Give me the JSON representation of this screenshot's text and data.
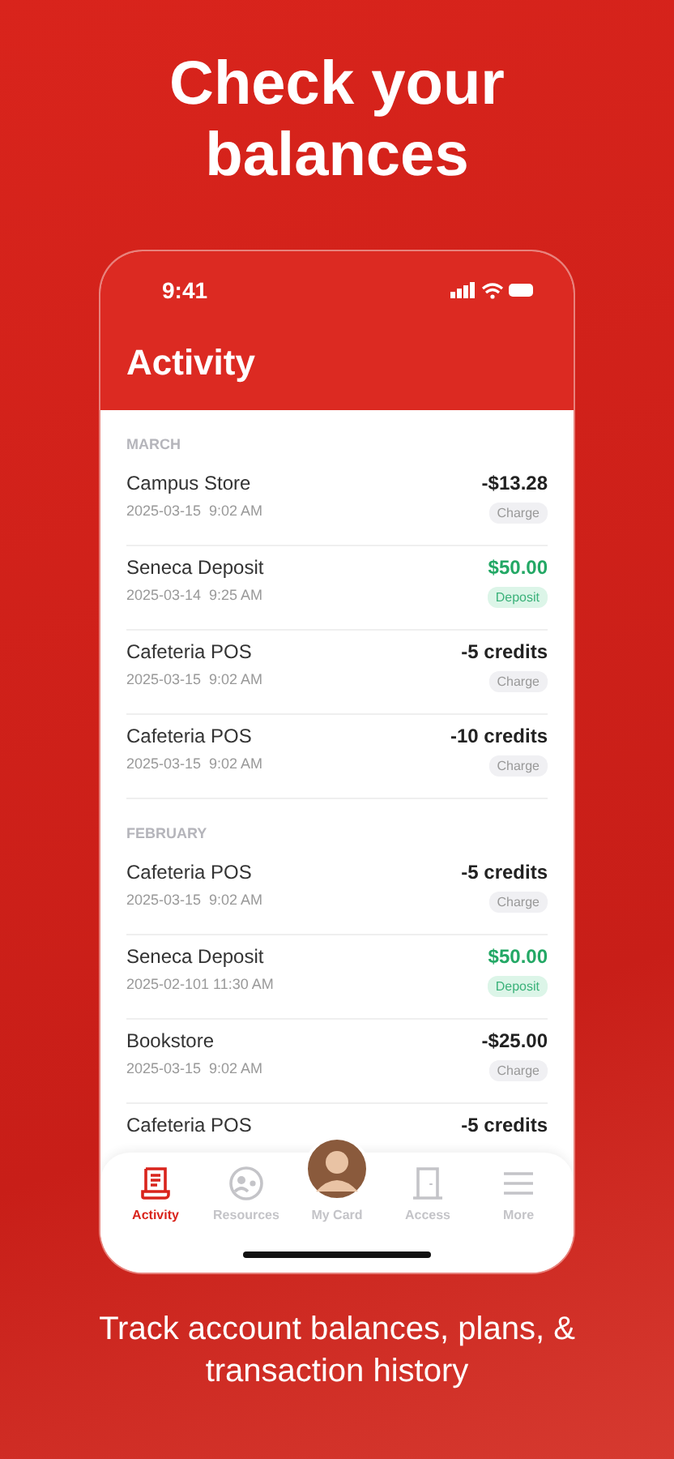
{
  "headline": "Check your balances",
  "phone": {
    "status_bar": {
      "time": "9:41"
    },
    "title": "Activity",
    "sections": [
      {
        "label": "MARCH",
        "transactions": [
          {
            "name": "Campus Store",
            "date": "2025-03-15  9:02 AM",
            "amount": "-$13.28",
            "kind": "charge",
            "tag": "Charge"
          },
          {
            "name": "Seneca Deposit",
            "date": "2025-03-14  9:25 AM",
            "amount": "$50.00",
            "kind": "deposit",
            "tag": "Deposit"
          },
          {
            "name": "Cafeteria POS",
            "date": "2025-03-15  9:02 AM",
            "amount": "-5 credits",
            "kind": "charge",
            "tag": "Charge"
          },
          {
            "name": "Cafeteria POS",
            "date": "2025-03-15  9:02 AM",
            "amount": "-10 credits",
            "kind": "charge",
            "tag": "Charge"
          }
        ]
      },
      {
        "label": "FEBRUARY",
        "transactions": [
          {
            "name": "Cafeteria POS",
            "date": "2025-03-15  9:02 AM",
            "amount": "-5 credits",
            "kind": "charge",
            "tag": "Charge"
          },
          {
            "name": "Seneca Deposit",
            "date": "2025-02-101 11:30 AM",
            "amount": "$50.00",
            "kind": "deposit",
            "tag": "Deposit"
          },
          {
            "name": "Bookstore",
            "date": "2025-03-15  9:02 AM",
            "amount": "-$25.00",
            "kind": "charge",
            "tag": "Charge"
          },
          {
            "name": "Cafeteria POS",
            "amount": "-5 credits",
            "kind": "charge"
          }
        ]
      }
    ],
    "tab_bar": [
      {
        "label": "Activity",
        "selected": true
      },
      {
        "label": "Resources",
        "selected": false
      },
      {
        "label": "My Card",
        "selected": false
      },
      {
        "label": "Access",
        "selected": false
      },
      {
        "label": "More",
        "selected": false
      }
    ]
  },
  "caption": "Track account balances, plans, & transaction history"
}
